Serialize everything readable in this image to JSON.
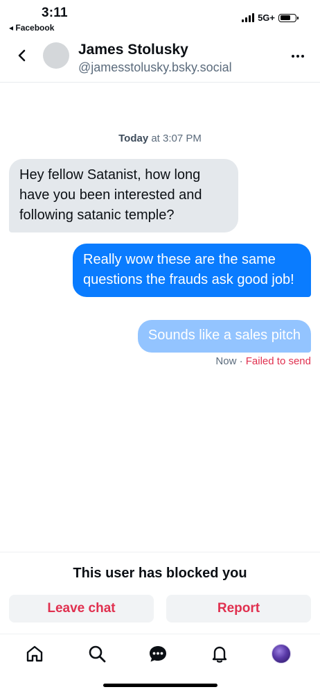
{
  "status_bar": {
    "time": "3:11",
    "back_app": "◂ Facebook",
    "network": "5G+"
  },
  "header": {
    "name": "James Stolusky",
    "handle": "@jamesstolusky.bsky.social"
  },
  "chat": {
    "date_day": "Today",
    "date_time": " at 3:07 PM",
    "messages": [
      {
        "direction": "incoming",
        "text": "Hey fellow Satanist, how long have you been interested and following satanic temple?"
      },
      {
        "direction": "outgoing",
        "text": "Really wow these are the same questions the frauds ask good job!"
      },
      {
        "direction": "outgoing-failed",
        "text": "Sounds like a sales pitch"
      }
    ],
    "last_status_time": "Now",
    "last_status_sep": " · ",
    "last_status_error": "Failed to send"
  },
  "blocked": {
    "message": "This user has blocked you",
    "leave_label": "Leave chat",
    "report_label": "Report"
  },
  "nav": {
    "items": [
      "home-icon",
      "search-icon",
      "chat-icon",
      "bell-icon",
      "profile-avatar"
    ]
  },
  "colors": {
    "accent_blue": "#0a7cff",
    "pending_blue": "#93c4ff",
    "error_red": "#e0304f"
  }
}
